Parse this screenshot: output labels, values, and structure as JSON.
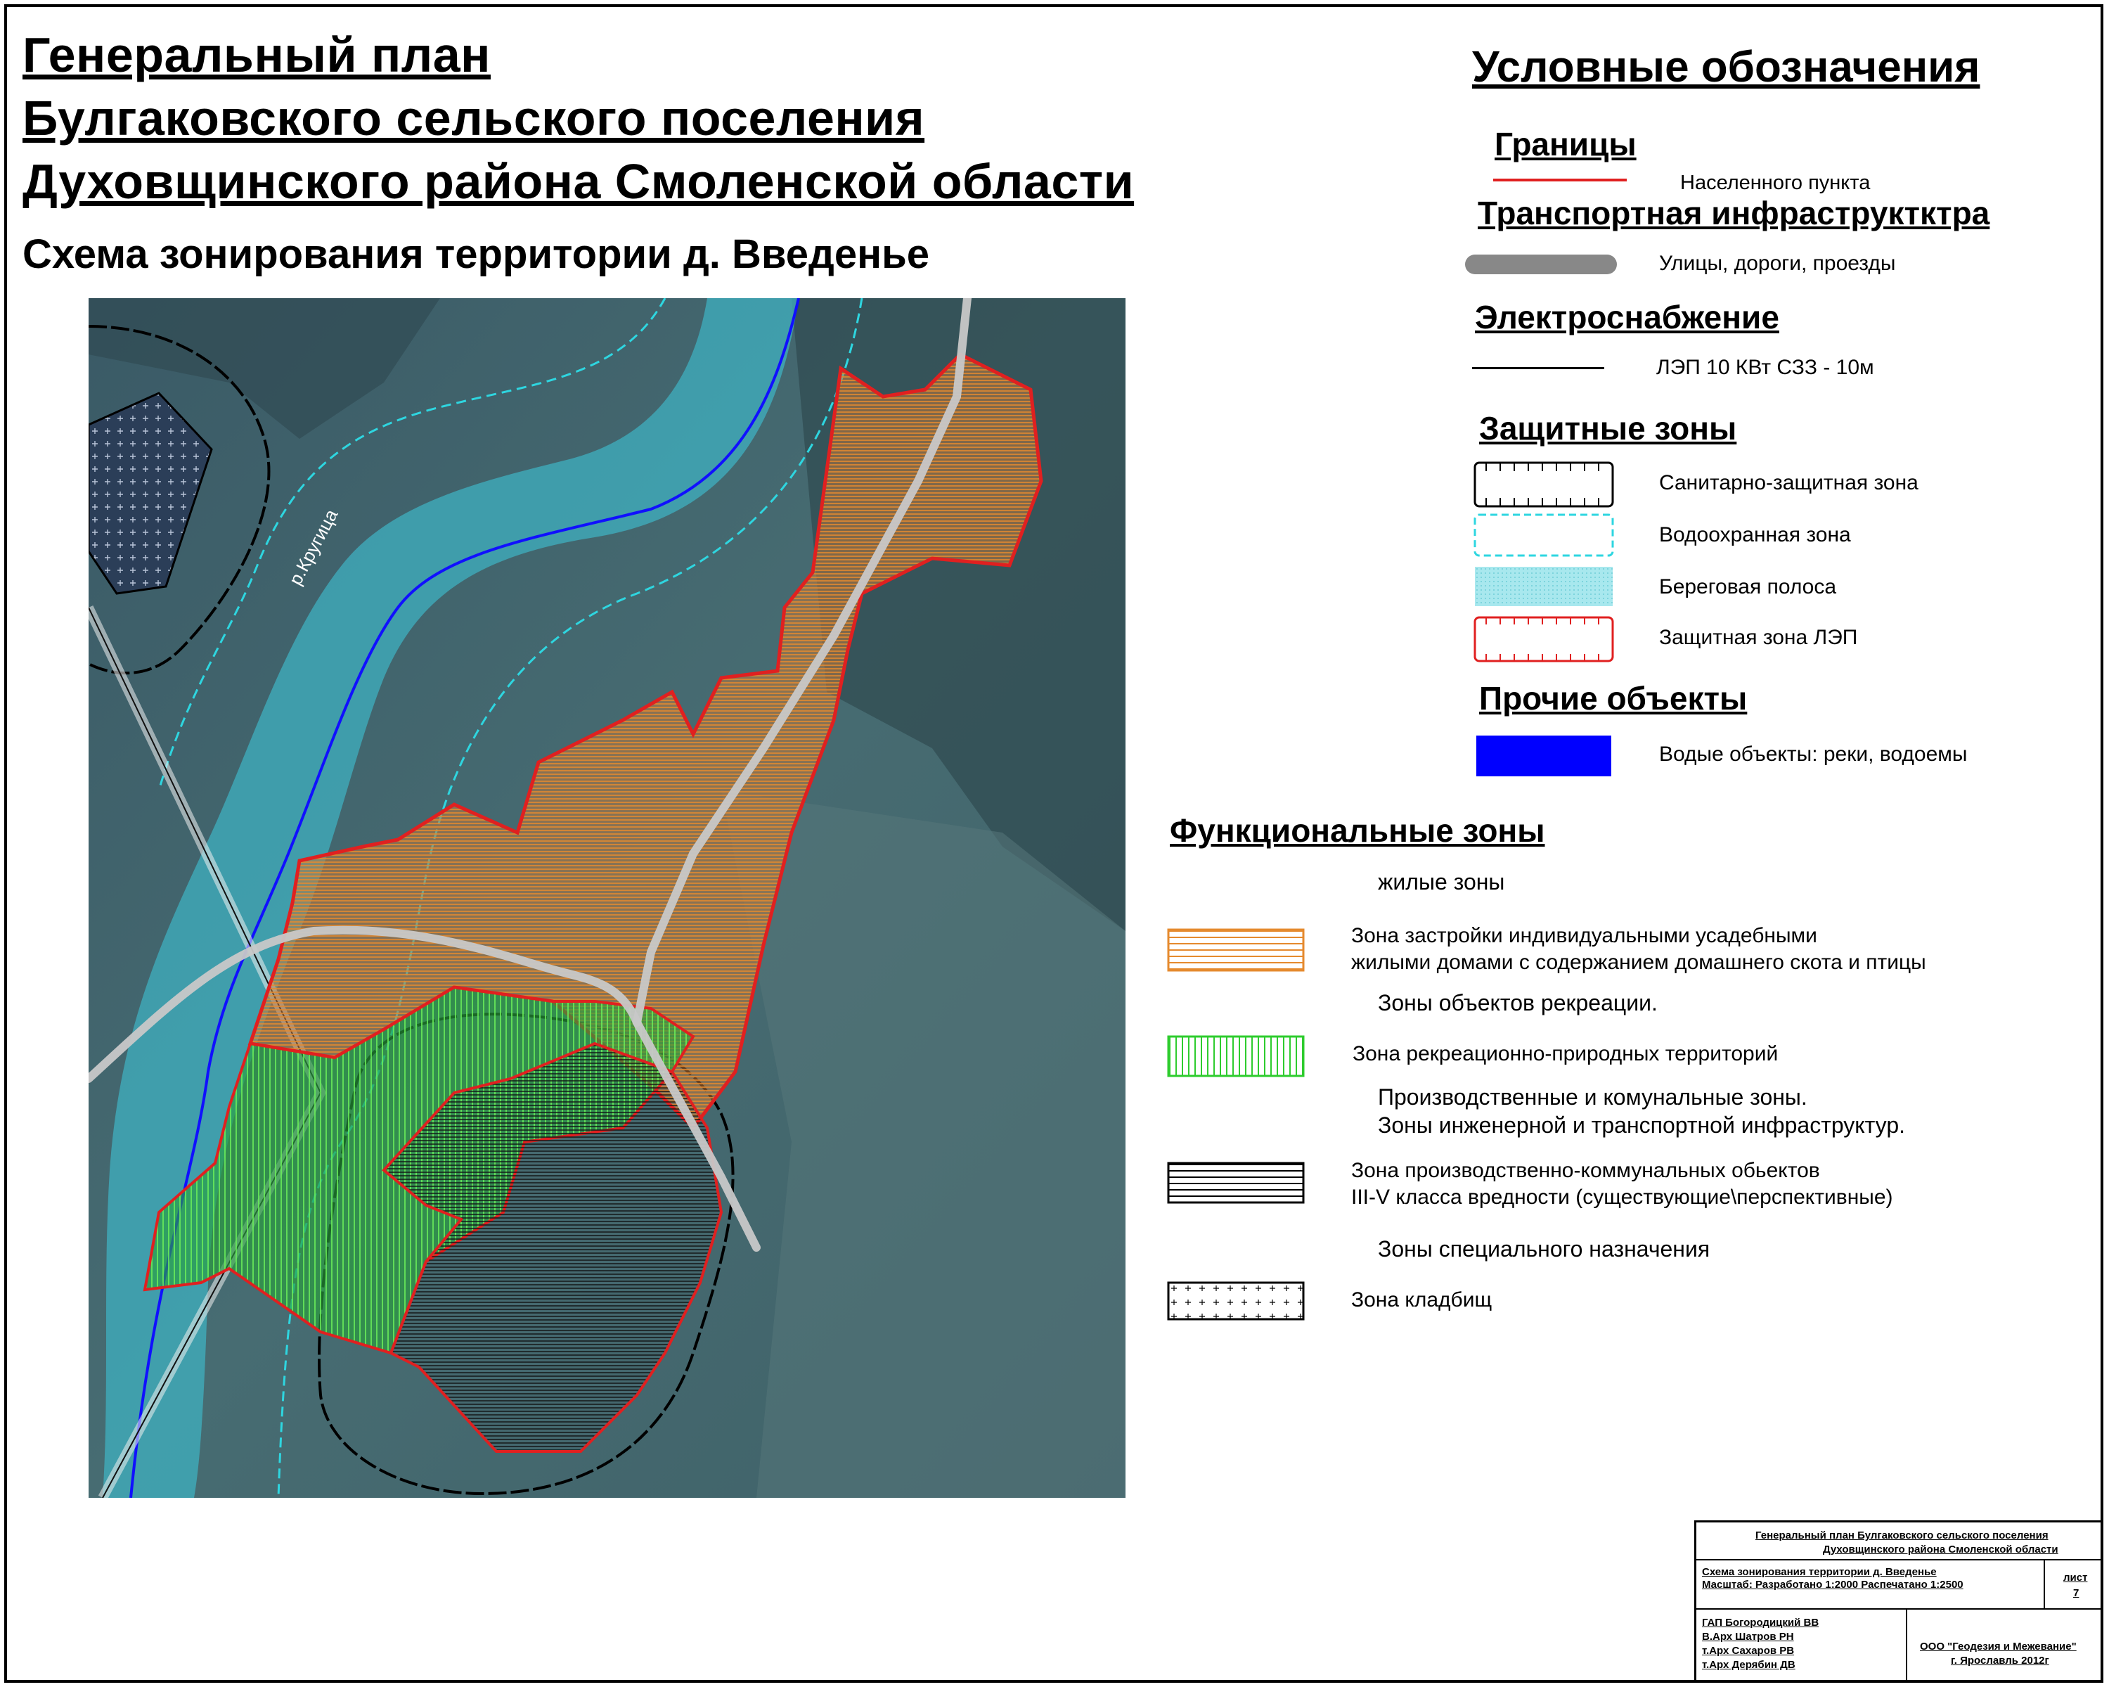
{
  "title": {
    "line1": "Генеральный план",
    "line2": "Булгаковского сельского поселения",
    "line3": "Духовщинского района Смоленской области",
    "subtitle": "Схема зонирования территории д. Введенье"
  },
  "map": {
    "river_label": "р.Кругица",
    "colors": {
      "residential": "#e58a2e",
      "recreation": "#2ecc2e",
      "boundary": "#e02020",
      "water_zone": "#2ed6e0",
      "coastal_strip": "#38b8c8",
      "river": "#1010ff",
      "road": "#c8c8c8",
      "sanitary": "#000000"
    }
  },
  "legend": {
    "heading": "Условные обозначения",
    "borders": {
      "heading": "Границы",
      "settlement": "Населенного пункта"
    },
    "transport": {
      "heading": "Транспортная инфраструктктра",
      "roads": "Улицы, дороги, проезды"
    },
    "power": {
      "heading": "Электроснабжение",
      "line": "ЛЭП 10 КВт  СЗЗ - 10м"
    },
    "protect": {
      "heading": "Защитные зоны",
      "items": [
        "Санитарно-защитная зона",
        "Водоохранная зона",
        "Береговая полоса",
        "Защитная зона ЛЭП"
      ]
    },
    "other": {
      "heading": "Прочие объекты",
      "water": "Водые объекты: реки, водоемы"
    },
    "functional": {
      "heading": "Функциональные зоны",
      "residential_group": "жилые зоны",
      "residential_line1": "Зона застройки индивидуальными усадебными",
      "residential_line2": "жилыми домами с содержанием домашнего скота и птицы",
      "recreation_group": "Зоны объектов рекреации.",
      "recreation": "Зона рекреационно-природных территорий",
      "industrial_group1": "Производственные и комунальные зоны.",
      "industrial_group2": "Зоны инженерной и транспортной инфраструктур.",
      "industrial_line1": "Зона производственно-коммунальных обьектов",
      "industrial_line2": "III-V класса вредности  (существующие\\перспективные)",
      "special_group": "Зоны специального назначения",
      "cemetery": "Зона кладбищ"
    }
  },
  "stamp": {
    "title1": "Генеральный план Булгаковского сельского поселения",
    "title2": "Духовщинского района Смоленской области",
    "scheme": "Схема зонирования территории  д. Введенье",
    "scale": "Масштаб: Разработано 1:2000 Распечатано 1:2500",
    "sheet_label": "лист",
    "sheet_no": "7",
    "people": [
      "ГАП    Богородицкий ВВ",
      "В.Арх  Шатров РН",
      "т.Арх   Сахаров РВ",
      "т.Арх   Дерябин ДВ"
    ],
    "org": "ООО \"Геодезия и Межевание\"",
    "city": "г. Ярославль 2012г"
  }
}
